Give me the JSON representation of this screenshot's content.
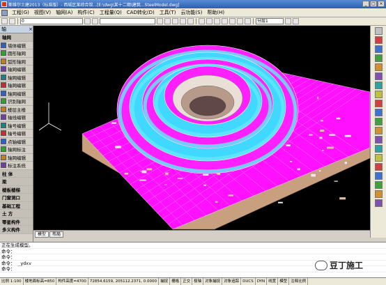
{
  "window": {
    "title": "斯维尔土建2013（标准版）- 西城区某综合馆...[E:\\dwg\\某十二期\\建筑...SteelModel.dwg]"
  },
  "menubar": {
    "items": [
      "工程(G)",
      "视图(V)",
      "轴网(A)",
      "构件(C)",
      "工程量(Q)",
      "CAD转化(D)",
      "工具(T)",
      "云功能(S)",
      "帮助(H)"
    ]
  },
  "toolbar": {
    "layer_combo": "0",
    "color_combo": "",
    "right_combo": "分层1"
  },
  "left_panel": {
    "header": "轴",
    "rows": [
      {
        "label": "轴网",
        "group": true
      },
      {
        "label": "墙体编辑",
        "group": false
      },
      {
        "label": "圆形轴网",
        "group": false
      },
      {
        "label": "弧形轴网",
        "group": false
      },
      {
        "label": "轴网编辑",
        "group": false
      },
      {
        "label": "轴网编辑",
        "group": false
      },
      {
        "label": "轴网编辑",
        "group": false
      },
      {
        "label": "轴网编辑",
        "group": false
      },
      {
        "label": "识别轴网",
        "group": false
      },
      {
        "label": "楼层主楼",
        "group": false
      },
      {
        "label": "轴线编辑",
        "group": false
      },
      {
        "label": "轴号编辑",
        "group": false
      },
      {
        "label": "轴号编辑",
        "group": false
      },
      {
        "label": "点轴编辑",
        "group": false
      },
      {
        "label": "轴网标注",
        "group": false
      },
      {
        "label": "轴网编辑",
        "group": false
      },
      {
        "label": "标注系统",
        "group": false
      },
      {
        "label": "柱 体",
        "group": true
      },
      {
        "label": "梁",
        "group": true
      },
      {
        "label": "楼板楼梯",
        "group": true
      },
      {
        "label": "门窗洞口",
        "group": true
      },
      {
        "label": "基础工程",
        "group": true
      },
      {
        "label": "土 方",
        "group": true
      },
      {
        "label": "零星构件",
        "group": true
      },
      {
        "label": "多义构件",
        "group": true
      }
    ]
  },
  "tabs": [
    "模型",
    "布局"
  ],
  "command": {
    "lines": [
      "正在生成模型。",
      "命令：",
      "命令：",
      "命令：  _ydxv",
      "命令："
    ]
  },
  "statusbar": {
    "cells": [
      "比例 1:100",
      "楼地面标高=850",
      "构件高度=4700",
      "72854.6159, 205112.2371, 0.0000",
      "捕捉",
      "栅格",
      "正交",
      "极轴",
      "对象捕捉",
      "对象追踪",
      "DUCS",
      "DYN",
      "线宽",
      "模型",
      "注释比例"
    ]
  },
  "watermark": {
    "text": "豆丁施工"
  },
  "colors": {
    "viewport_bg": "#000000",
    "floor": "#ff00ff",
    "shell": "#30d8ff",
    "edge": "#ffffff"
  }
}
